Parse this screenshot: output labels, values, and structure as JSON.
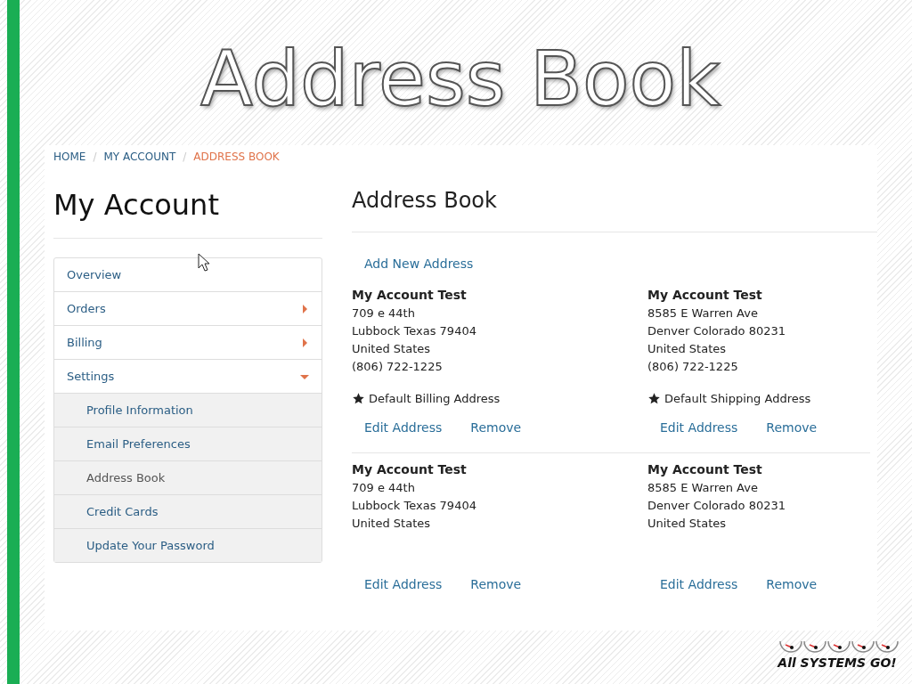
{
  "slide_title": "Address Book",
  "breadcrumb_separator": "/",
  "breadcrumb": [
    {
      "label": "HOME",
      "selected": false
    },
    {
      "label": "MY ACCOUNT",
      "selected": false
    },
    {
      "label": "ADDRESS BOOK",
      "selected": true
    }
  ],
  "sidebar": {
    "title": "My Account",
    "items": [
      {
        "label": "Overview",
        "kind": "link"
      },
      {
        "label": "Orders",
        "kind": "group",
        "expanded": false
      },
      {
        "label": "Billing",
        "kind": "group",
        "expanded": false
      },
      {
        "label": "Settings",
        "kind": "group",
        "expanded": true,
        "children": [
          {
            "label": "Profile Information",
            "selected": false
          },
          {
            "label": "Email Preferences",
            "selected": false
          },
          {
            "label": "Address Book",
            "selected": true
          },
          {
            "label": "Credit Cards",
            "selected": false
          },
          {
            "label": "Update Your Password",
            "selected": false
          }
        ]
      }
    ]
  },
  "main": {
    "title": "Address Book",
    "add_link": "Add New Address",
    "addresses": [
      {
        "name": "My Account Test",
        "lines": [
          "709 e 44th",
          "Lubbock Texas 79404",
          "United States",
          "(806) 722-1225"
        ],
        "default": "Default Billing Address",
        "actions": [
          "Edit Address",
          "Remove"
        ]
      },
      {
        "name": "My Account Test",
        "lines": [
          "8585 E Warren Ave",
          "Denver Colorado 80231",
          "United States",
          "(806) 722-1225"
        ],
        "default": "Default Shipping Address",
        "actions": [
          "Edit Address",
          "Remove"
        ]
      },
      {
        "name": "My Account Test",
        "lines": [
          "709 e 44th",
          "Lubbock Texas 79404",
          "United States"
        ],
        "actions": [
          "Edit Address",
          "Remove"
        ]
      },
      {
        "name": "My Account Test",
        "lines": [
          "8585 E Warren Ave",
          "Denver Colorado 80231",
          "United States"
        ],
        "actions": [
          "Edit Address",
          "Remove"
        ]
      }
    ]
  },
  "logo": {
    "text": "All SYSTEMS GO!"
  }
}
